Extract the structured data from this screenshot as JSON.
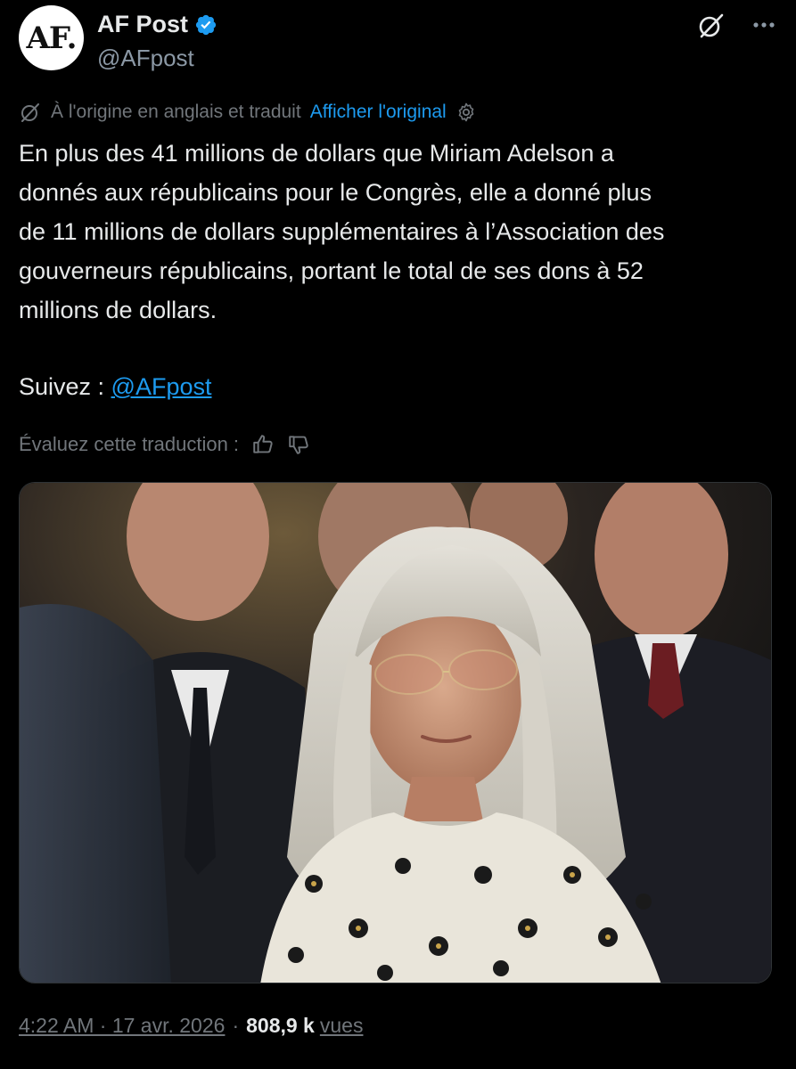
{
  "author": {
    "display_name": "AF Post",
    "handle": "@AFpost",
    "avatar_text": "AF.",
    "verified": true,
    "verified_color": "#1d9bf0"
  },
  "header_icons": {
    "grok": "grok-slash-icon",
    "more": "more-horizontal-icon"
  },
  "translation": {
    "notice": "À l'origine en anglais et traduit",
    "show_original": "Afficher l'original",
    "icon": "translate-icon",
    "settings_icon": "gear-icon"
  },
  "tweet": {
    "text": "En plus des 41 millions de dollars que Miriam Adelson a\ndonnés aux républicains pour le Congrès, elle a donné plus\nde 11 millions de dollars supplémentaires à l’Association des\ngouverneurs républicains, portant le total de ses dons à 52\nmillions de dollars.",
    "follow_prefix": "Suivez : ",
    "follow_link": "@AFpost"
  },
  "rating": {
    "label": "Évaluez cette traduction :",
    "thumbs_up_icon": "thumbs-up-icon",
    "thumbs_down_icon": "thumbs-down-icon"
  },
  "media": {
    "type": "photo"
  },
  "meta": {
    "time": "4:22 AM · 17 avr. 2026",
    "separator": "·",
    "views_count": "808,9 k",
    "views_label": "vues"
  },
  "colors": {
    "background": "#000000",
    "text": "#e7e9ea",
    "secondary": "#71767b",
    "accent": "#1d9bf0"
  }
}
